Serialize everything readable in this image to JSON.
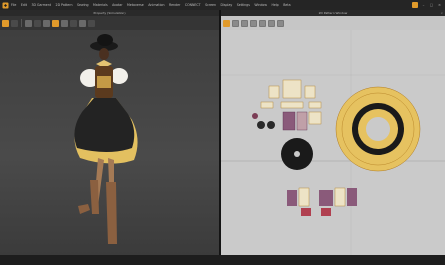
{
  "menubar": {
    "items": [
      "File",
      "Edit",
      "3D Garment",
      "2D Pattern",
      "Sewing",
      "Materials",
      "Avatar",
      "Metaverse",
      "Animation",
      "Render",
      "CONNECT",
      "Screen",
      "Display",
      "Settings",
      "Window",
      "Help",
      "Beta"
    ]
  },
  "left_panel": {
    "title": "Property (Simulation)"
  },
  "right_panel": {
    "title": "2D Pattern Window"
  },
  "colors": {
    "accent": "#e09a2b",
    "pattern_fill": "#ede3c6",
    "pattern_stroke": "#b07a1e",
    "ring_fill": "#e6c260"
  },
  "icons": [
    "app-logo-icon",
    "move-icon",
    "select-icon",
    "sew-icon",
    "avatar-icon",
    "fold-icon",
    "pin-icon",
    "measure-icon",
    "texture-icon",
    "view-icon"
  ]
}
